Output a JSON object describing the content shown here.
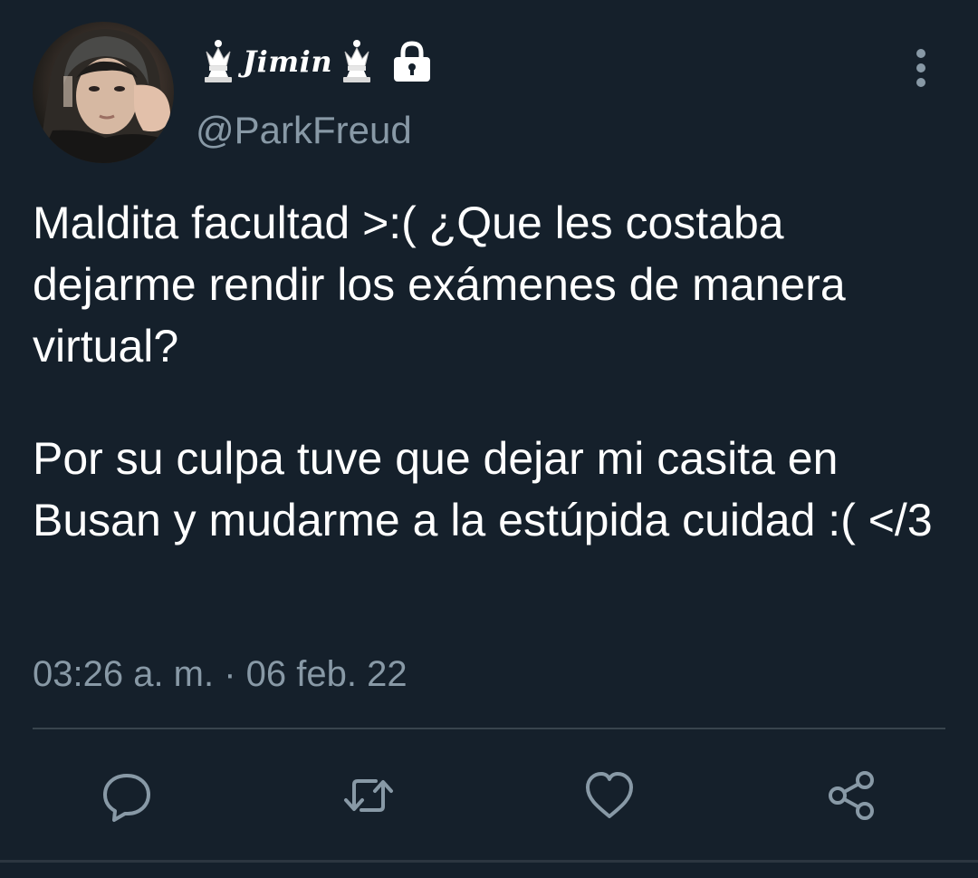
{
  "user": {
    "display_name": "Jimin",
    "handle": "@ParkFreud",
    "avatar": "profile-photo",
    "name_decoration_icon": "chess-queen-icon",
    "protected_icon": "lock-icon"
  },
  "tweet": {
    "paragraphs": [
      "Maldita facultad >:( ¿Que les costaba dejarme rendir los exámenes de manera virtual?",
      "Por su culpa tuve que dejar mi casita en Busan y mudarme a la estúpida cuidad :( </3"
    ],
    "timestamp": "03:26 a. m. · 06 feb. 22"
  },
  "menu_icon": "more-vertical-icon",
  "actions": [
    {
      "name": "reply",
      "icon": "reply-icon"
    },
    {
      "name": "retweet",
      "icon": "retweet-icon"
    },
    {
      "name": "like",
      "icon": "heart-icon"
    },
    {
      "name": "share",
      "icon": "share-icon"
    }
  ],
  "colors": {
    "background": "#15202b",
    "text": "#ffffff",
    "secondary_text": "#8899a6",
    "divider": "#38444d"
  }
}
